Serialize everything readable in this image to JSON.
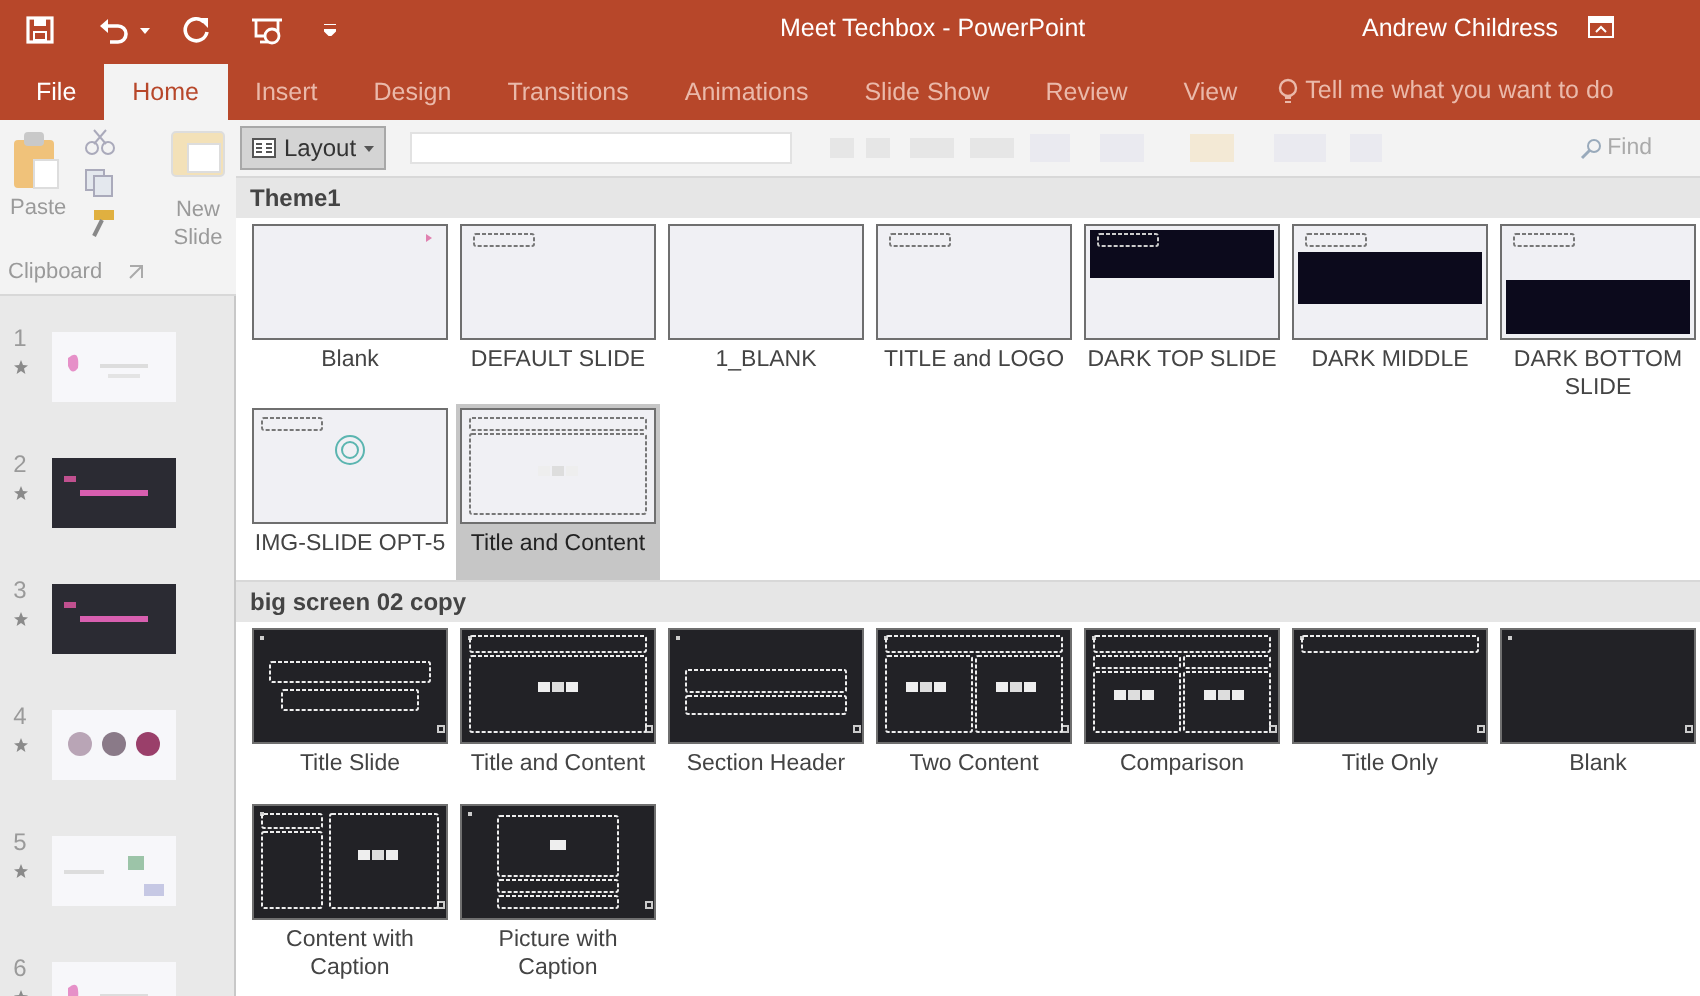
{
  "titlebar": {
    "title": "Meet Techbox  -  PowerPoint",
    "user": "Andrew Childress"
  },
  "tabs": [
    {
      "label": "File",
      "selected": false
    },
    {
      "label": "Home",
      "selected": true
    },
    {
      "label": "Insert",
      "selected": false
    },
    {
      "label": "Design",
      "selected": false
    },
    {
      "label": "Transitions",
      "selected": false
    },
    {
      "label": "Animations",
      "selected": false
    },
    {
      "label": "Slide Show",
      "selected": false
    },
    {
      "label": "Review",
      "selected": false
    },
    {
      "label": "View",
      "selected": false
    }
  ],
  "tell_me": {
    "placeholder": "Tell me what you want to do"
  },
  "clipboard": {
    "paste": "Paste",
    "new_slide": "New Slide",
    "group": "Clipboard"
  },
  "layout_button": {
    "label": "Layout",
    "expanded": true
  },
  "find": "Find",
  "slides": [
    {
      "number": "1",
      "kind": "light"
    },
    {
      "number": "2",
      "kind": "dark"
    },
    {
      "number": "3",
      "kind": "dark"
    },
    {
      "number": "4",
      "kind": "circles"
    },
    {
      "number": "5",
      "kind": "diagram"
    },
    {
      "number": "6",
      "kind": "light"
    }
  ],
  "layout_groups": [
    {
      "name": "Theme1",
      "layouts": [
        {
          "label": "Blank",
          "kind": "blank-mark",
          "selected": false
        },
        {
          "label": "DEFAULT SLIDE",
          "kind": "title-box",
          "selected": false
        },
        {
          "label": "1_BLANK",
          "kind": "empty",
          "selected": false
        },
        {
          "label": "TITLE and LOGO",
          "kind": "title-box",
          "selected": false
        },
        {
          "label": "DARK TOP SLIDE",
          "kind": "dark-top",
          "selected": false
        },
        {
          "label": "DARK MIDDLE",
          "kind": "dark-middle",
          "selected": false
        },
        {
          "label": "DARK BOTTOM SLIDE",
          "kind": "dark-bottom",
          "selected": false
        },
        {
          "label": "IMG-SLIDE OPT-5",
          "kind": "img",
          "selected": false
        },
        {
          "label": "Title and Content",
          "kind": "title-content",
          "selected": true
        }
      ]
    },
    {
      "name": "big screen 02 copy",
      "layouts": [
        {
          "label": "Title Slide",
          "kind": "d-title-slide",
          "selected": false
        },
        {
          "label": "Title and Content",
          "kind": "d-title-content",
          "selected": false
        },
        {
          "label": "Section Header",
          "kind": "d-section-header",
          "selected": false
        },
        {
          "label": "Two Content",
          "kind": "d-two-content",
          "selected": false
        },
        {
          "label": "Comparison",
          "kind": "d-comparison",
          "selected": false
        },
        {
          "label": "Title Only",
          "kind": "d-title-only",
          "selected": false
        },
        {
          "label": "Blank",
          "kind": "d-blank",
          "selected": false
        },
        {
          "label": "Content with Caption",
          "kind": "d-content-caption",
          "selected": false
        },
        {
          "label": "Picture with Caption",
          "kind": "d-picture-caption",
          "selected": false
        }
      ]
    }
  ]
}
